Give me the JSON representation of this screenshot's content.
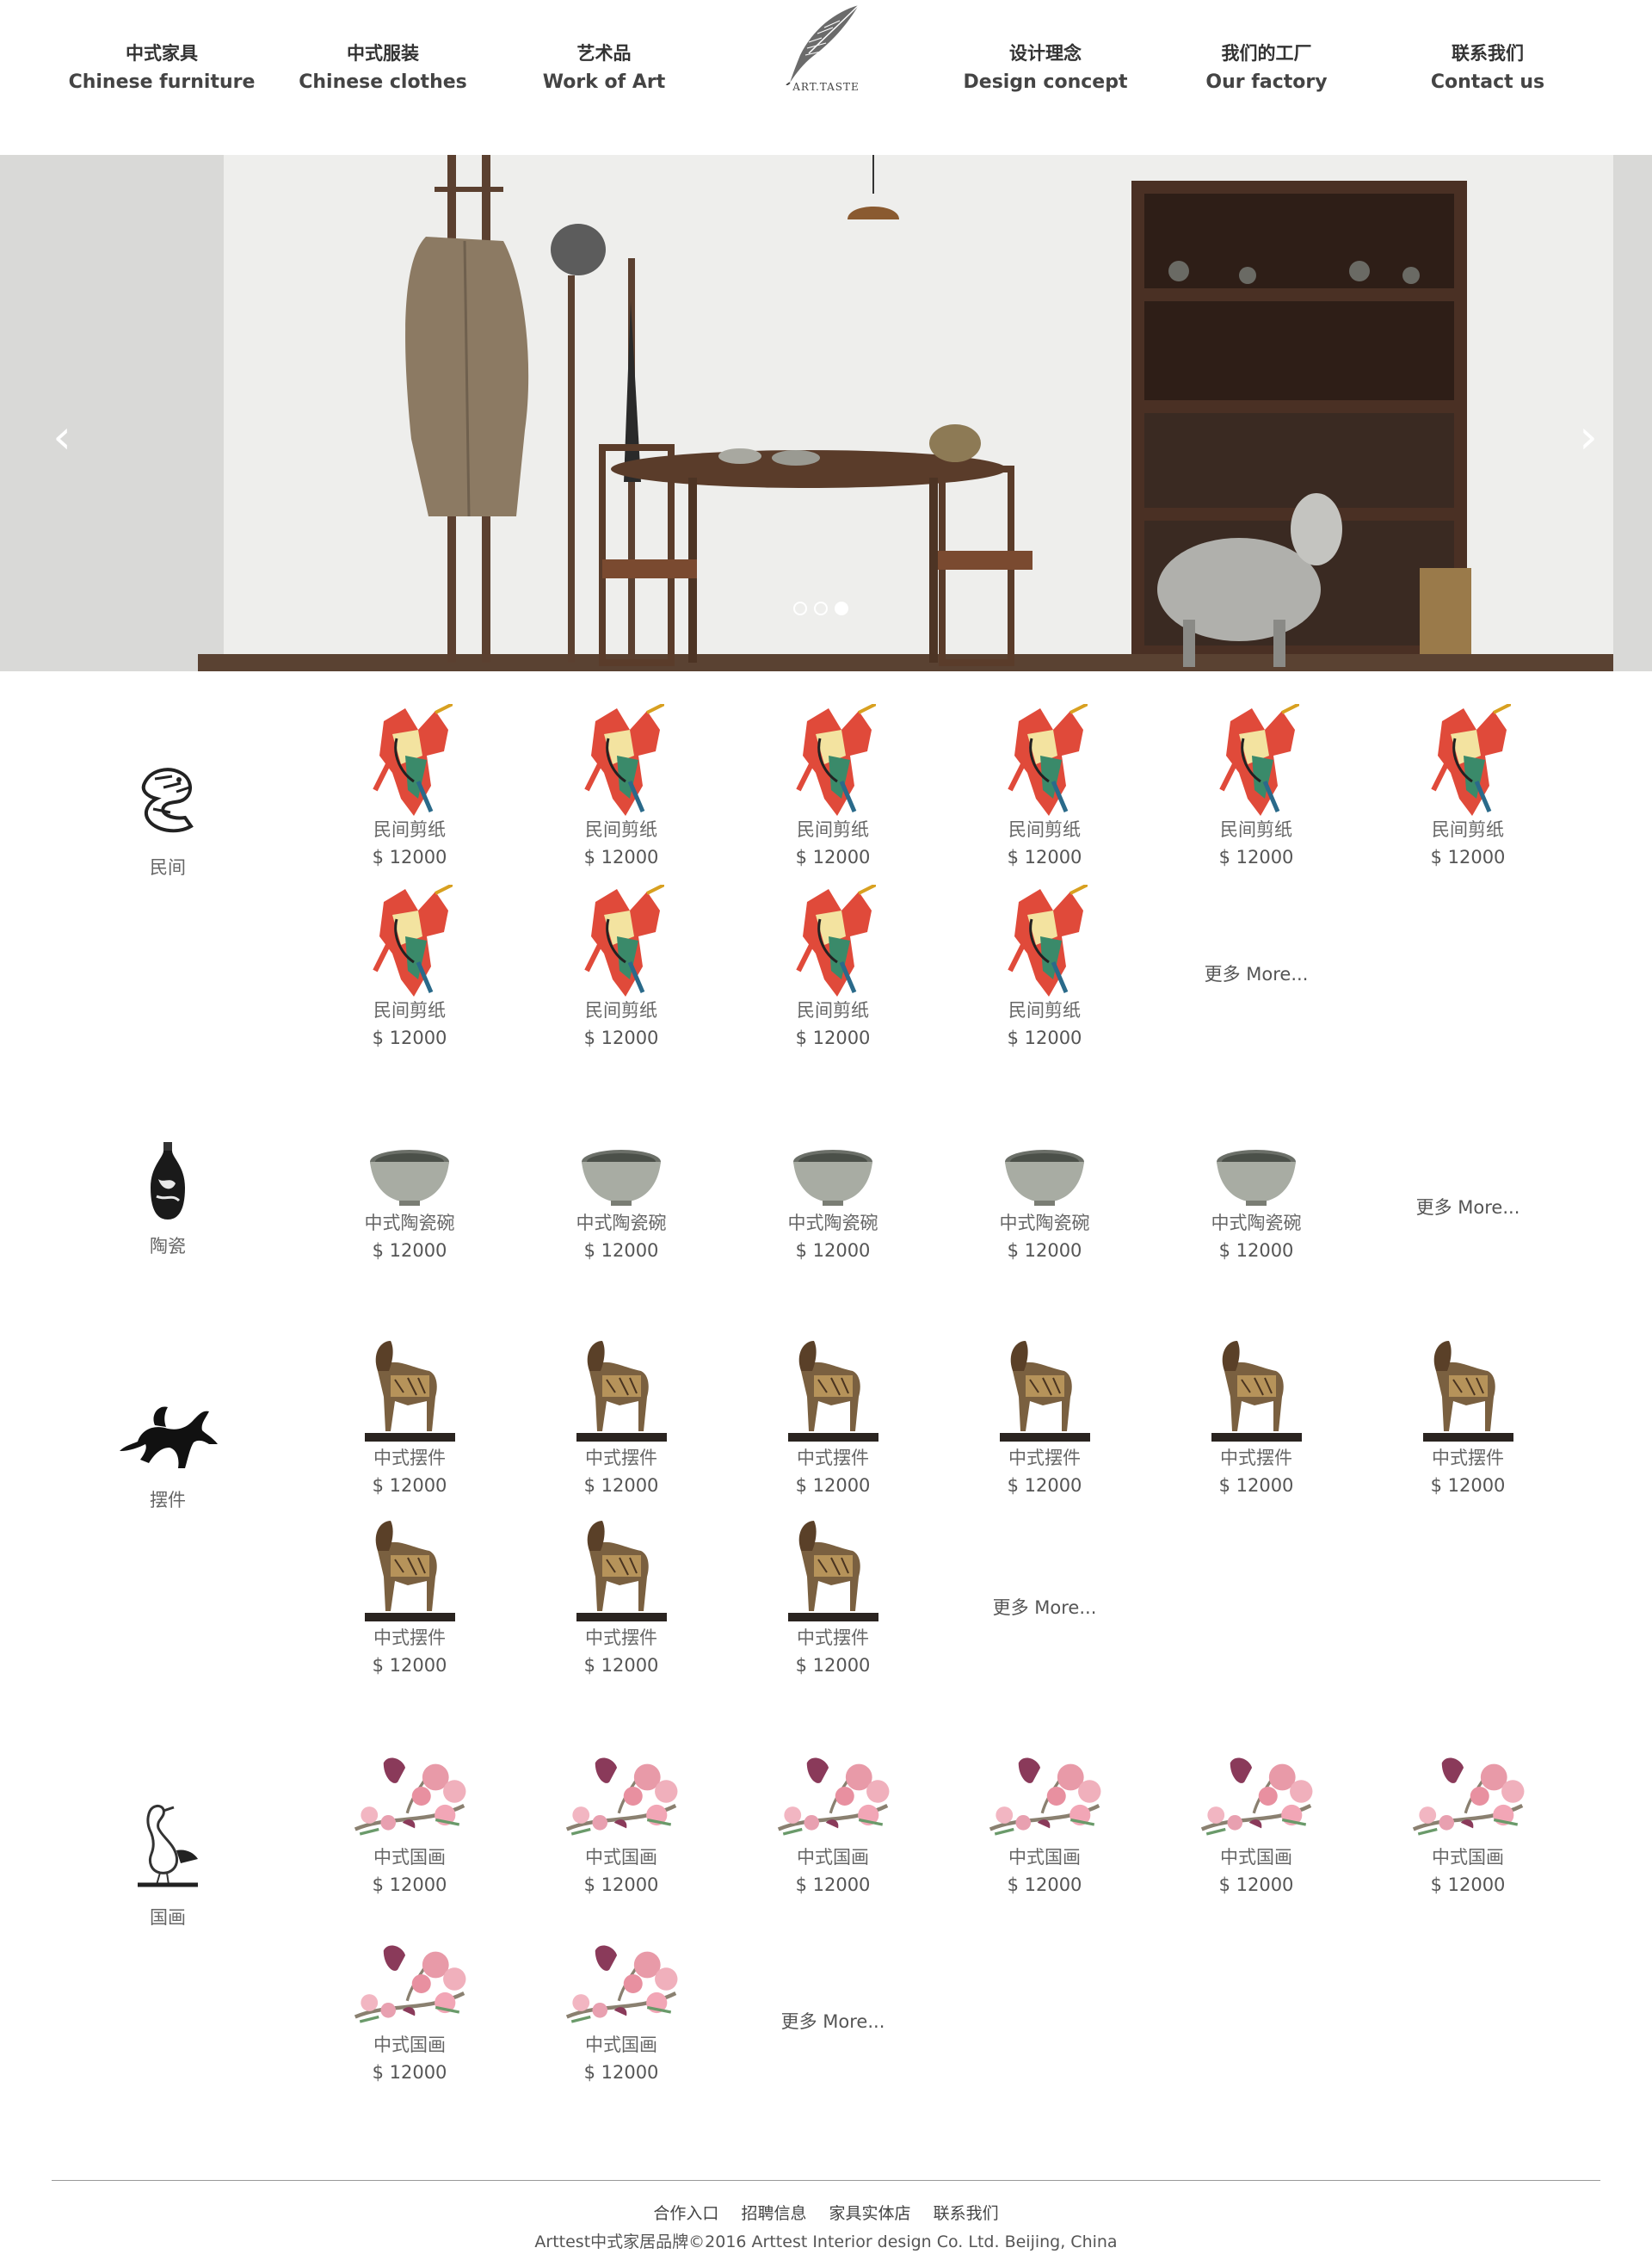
{
  "nav": {
    "left": [
      {
        "zh": "中式家具",
        "en": "Chinese furniture"
      },
      {
        "zh": "中式服装",
        "en": "Chinese clothes"
      },
      {
        "zh": "艺术品",
        "en": "Work of Art"
      }
    ],
    "right": [
      {
        "zh": "设计理念",
        "en": "Design concept"
      },
      {
        "zh": "我们的工厂",
        "en": "Our factory"
      },
      {
        "zh": "联系我们",
        "en": "Contact us"
      }
    ],
    "logo_text": "ART.TASTE"
  },
  "banner": {
    "prev_icon": "‹",
    "next_icon": "›",
    "slide_count": 3,
    "active_slide": 3
  },
  "sections": [
    {
      "category": "民间",
      "icon": "paper-cut-dragon-icon",
      "items": [
        {
          "name": "民间剪纸",
          "price": "$ 12000"
        },
        {
          "name": "民间剪纸",
          "price": "$ 12000"
        },
        {
          "name": "民间剪纸",
          "price": "$ 12000"
        },
        {
          "name": "民间剪纸",
          "price": "$ 12000"
        },
        {
          "name": "民间剪纸",
          "price": "$ 12000"
        },
        {
          "name": "民间剪纸",
          "price": "$ 12000"
        },
        {
          "name": "民间剪纸",
          "price": "$ 12000"
        },
        {
          "name": "民间剪纸",
          "price": "$ 12000"
        },
        {
          "name": "民间剪纸",
          "price": "$ 12000"
        },
        {
          "name": "民间剪纸",
          "price": "$ 12000"
        }
      ],
      "more": "更多 More..."
    },
    {
      "category": "陶瓷",
      "icon": "vase-icon",
      "items": [
        {
          "name": "中式陶瓷碗",
          "price": "$ 12000"
        },
        {
          "name": "中式陶瓷碗",
          "price": "$ 12000"
        },
        {
          "name": "中式陶瓷碗",
          "price": "$ 12000"
        },
        {
          "name": "中式陶瓷碗",
          "price": "$ 12000"
        },
        {
          "name": "中式陶瓷碗",
          "price": "$ 12000"
        }
      ],
      "more": "更多 More..."
    },
    {
      "category": "摆件",
      "icon": "flying-horse-icon",
      "items": [
        {
          "name": "中式摆件",
          "price": "$ 12000"
        },
        {
          "name": "中式摆件",
          "price": "$ 12000"
        },
        {
          "name": "中式摆件",
          "price": "$ 12000"
        },
        {
          "name": "中式摆件",
          "price": "$ 12000"
        },
        {
          "name": "中式摆件",
          "price": "$ 12000"
        },
        {
          "name": "中式摆件",
          "price": "$ 12000"
        },
        {
          "name": "中式摆件",
          "price": "$ 12000"
        },
        {
          "name": "中式摆件",
          "price": "$ 12000"
        },
        {
          "name": "中式摆件",
          "price": "$ 12000"
        }
      ],
      "more": "更多 More..."
    },
    {
      "category": "国画",
      "icon": "crane-icon",
      "items": [
        {
          "name": "中式国画",
          "price": "$ 12000"
        },
        {
          "name": "中式国画",
          "price": "$ 12000"
        },
        {
          "name": "中式国画",
          "price": "$ 12000"
        },
        {
          "name": "中式国画",
          "price": "$ 12000"
        },
        {
          "name": "中式国画",
          "price": "$ 12000"
        },
        {
          "name": "中式国画",
          "price": "$ 12000"
        },
        {
          "name": "中式国画",
          "price": "$ 12000"
        },
        {
          "name": "中式国画",
          "price": "$ 12000"
        }
      ],
      "more": "更多 More..."
    }
  ],
  "footer": {
    "links": [
      "合作入口",
      "招聘信息",
      "家具实体店",
      "联系我们"
    ],
    "copyright": "Arttest中式家居品牌©2016 Arttest Interior design Co. Ltd. Beijing, China"
  }
}
